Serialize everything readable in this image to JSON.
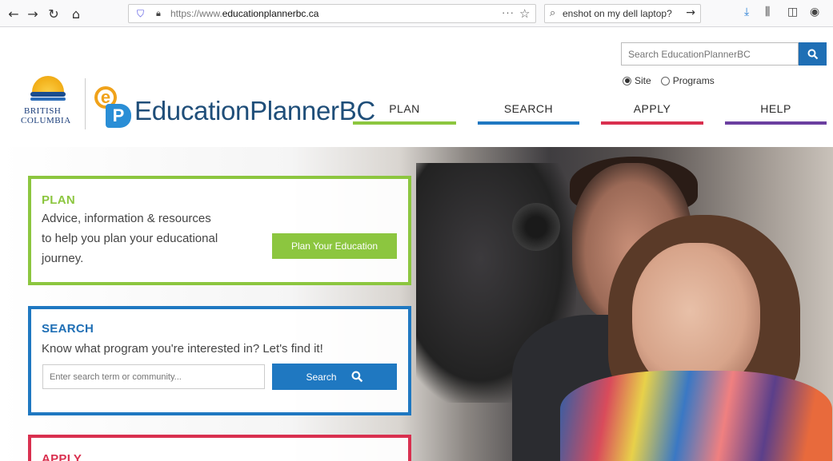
{
  "browser": {
    "back_icon": "←",
    "forward_icon": "→",
    "reload_icon": "↻",
    "home_icon": "⌂",
    "url_prefix": "https://www.",
    "url_domain": "educationplannerbc.ca",
    "more_icon": "···",
    "star_icon": "☆",
    "search_text": "enshot on my dell laptop?",
    "toolbar_icons": [
      "download-icon",
      "library-icon",
      "sidebar-icon",
      "account-icon"
    ]
  },
  "header": {
    "bc_logo_line1": "BRITISH",
    "bc_logo_line2": "COLUMBIA",
    "site_name": "EducationPlannerBC",
    "search_placeholder": "Search EducationPlannerBC",
    "radio_site": "Site",
    "radio_programs": "Programs",
    "selected_scope": "Site"
  },
  "nav": [
    {
      "label": "PLAN",
      "color": "#8cc63f"
    },
    {
      "label": "SEARCH",
      "color": "#1f78c1"
    },
    {
      "label": "APPLY",
      "color": "#d9304f"
    },
    {
      "label": "HELP",
      "color": "#6b3fa0"
    }
  ],
  "cards": {
    "plan": {
      "title": "PLAN",
      "line1": "Advice, information & resources",
      "line2": "to help you plan your educational",
      "line3": "journey.",
      "button": "Plan Your Education",
      "color": "#8cc63f"
    },
    "search": {
      "title": "SEARCH",
      "text": "Know what program you're interested in? Let's find it!",
      "placeholder": "Enter search term or community...",
      "button": "Search",
      "color": "#1f78c1"
    },
    "apply": {
      "title": "APPLY",
      "color": "#d9304f"
    }
  }
}
